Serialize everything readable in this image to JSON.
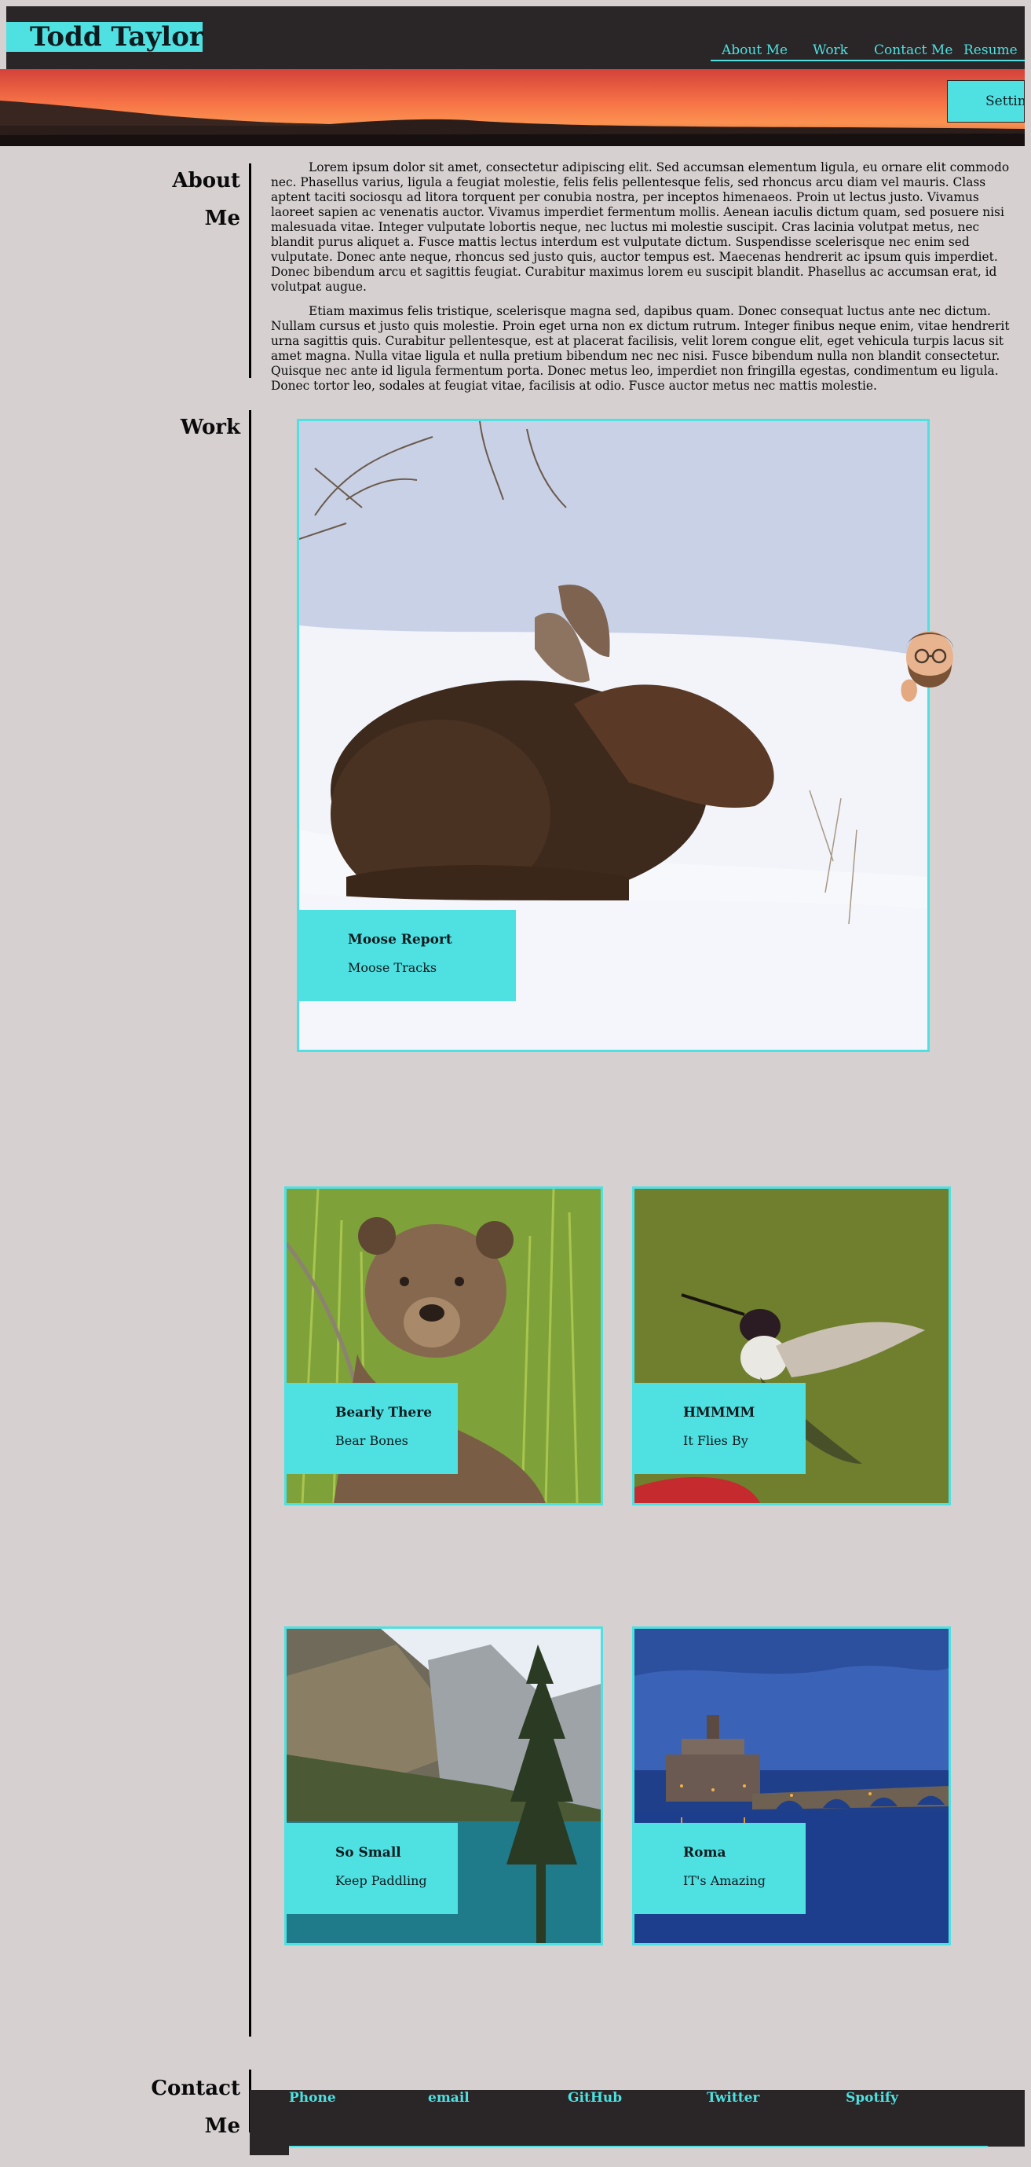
{
  "site": {
    "brand": "Todd Taylor"
  },
  "nav": {
    "items": [
      "About Me",
      "Work",
      "Contact Me",
      "Resume"
    ]
  },
  "hero": {
    "settings_label": "Settings"
  },
  "about": {
    "heading": "About Me",
    "paragraphs": [
      "Lorem ipsum dolor sit amet, consectetur adipiscing elit. Sed accumsan elementum ligula, eu ornare elit commodo nec. Phasellus varius, ligula a feugiat molestie, felis felis pellentesque felis, sed rhoncus arcu diam vel mauris. Class aptent taciti sociosqu ad litora torquent per conubia nostra, per inceptos himenaeos. Proin ut lectus justo. Vivamus laoreet sapien ac venenatis auctor. Vivamus imperdiet fermentum mollis. Aenean iaculis dictum quam, sed posuere nisi malesuada vitae. Integer vulputate lobortis neque, nec luctus mi molestie suscipit. Cras lacinia volutpat metus, nec blandit purus aliquet a. Fusce mattis lectus interdum est vulputate dictum. Suspendisse scelerisque nec enim sed vulputate. Donec ante neque, rhoncus sed justo quis, auctor tempus est. Maecenas hendrerit ac ipsum quis imperdiet. Donec bibendum arcu et sagittis feugiat. Curabitur maximus lorem eu suscipit blandit. Phasellus ac accumsan erat, id volutpat augue.",
      "Etiam maximus felis tristique, scelerisque magna sed, dapibus quam. Donec consequat luctus ante nec dictum. Nullam cursus et justo quis molestie. Proin eget urna non ex dictum rutrum. Integer finibus neque enim, vitae hendrerit urna sagittis quis. Curabitur pellentesque, est at placerat facilisis, velit lorem congue elit, eget vehicula turpis lacus sit amet magna. Nulla vitae ligula et nulla pretium bibendum nec nec nisi. Fusce bibendum nulla non blandit consectetur. Quisque nec ante id ligula fermentum porta. Donec metus leo, imperdiet non fringilla egestas, condimentum eu ligula. Donec tortor leo, sodales at feugiat vitae, facilisis at odio. Fusce auctor metus nec mattis molestie."
    ]
  },
  "work": {
    "heading": "Work",
    "cards": [
      {
        "title": "Moose Report",
        "subtitle": "Moose Tracks",
        "image": "moose-photo"
      },
      {
        "title": "Bearly There",
        "subtitle": "Bear Bones",
        "image": "bear-photo"
      },
      {
        "title": "HMMMM",
        "subtitle": "It Flies By",
        "image": "hummingbird-photo"
      },
      {
        "title": "So Small",
        "subtitle": "Keep Paddling",
        "image": "mountain-lake-photo"
      },
      {
        "title": "Roma",
        "subtitle": "IT's Amazing",
        "image": "rome-castle-photo"
      }
    ]
  },
  "contact": {
    "heading": "Contact Me",
    "items": [
      "Phone",
      "email",
      "GitHub",
      "Twitter",
      "Spotify"
    ]
  },
  "colors": {
    "accent": "#4fe0e1",
    "dark": "#2a2526",
    "background": "#d6d0d1"
  },
  "icons": {
    "avatar": "memoji-avatar-icon"
  }
}
